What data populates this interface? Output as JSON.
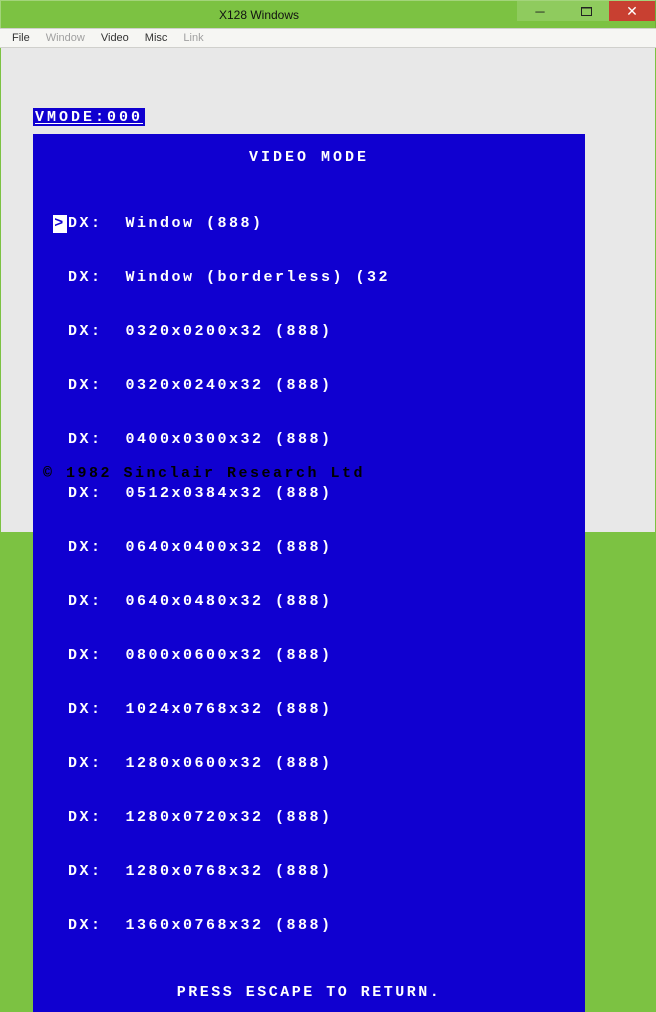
{
  "titlebar": {
    "title": "X128 Windows"
  },
  "menubar": {
    "items": [
      {
        "label": "File",
        "dim": false
      },
      {
        "label": "Window",
        "dim": true
      },
      {
        "label": "Video",
        "dim": false
      },
      {
        "label": "Misc",
        "dim": false
      },
      {
        "label": "Link",
        "dim": true
      }
    ]
  },
  "screen": {
    "vmode_header": "VMODE:000",
    "box_title": "VIDEO MODE",
    "modes": [
      {
        "selected": true,
        "text": "DX:  Window (888)"
      },
      {
        "selected": false,
        "text": "DX:  Window (borderless) (32"
      },
      {
        "selected": false,
        "text": "DX:  0320x0200x32 (888)"
      },
      {
        "selected": false,
        "text": "DX:  0320x0240x32 (888)"
      },
      {
        "selected": false,
        "text": "DX:  0400x0300x32 (888)"
      },
      {
        "selected": false,
        "text": "DX:  0512x0384x32 (888)"
      },
      {
        "selected": false,
        "text": "DX:  0640x0400x32 (888)"
      },
      {
        "selected": false,
        "text": "DX:  0640x0480x32 (888)"
      },
      {
        "selected": false,
        "text": "DX:  0800x0600x32 (888)"
      },
      {
        "selected": false,
        "text": "DX:  1024x0768x32 (888)"
      },
      {
        "selected": false,
        "text": "DX:  1280x0600x32 (888)"
      },
      {
        "selected": false,
        "text": "DX:  1280x0720x32 (888)"
      },
      {
        "selected": false,
        "text": "DX:  1280x0768x32 (888)"
      },
      {
        "selected": false,
        "text": "DX:  1360x0768x32 (888)"
      }
    ],
    "box_footer": "PRESS ESCAPE TO RETURN.",
    "copyright": "© 1982 Sinclair Research Ltd"
  }
}
